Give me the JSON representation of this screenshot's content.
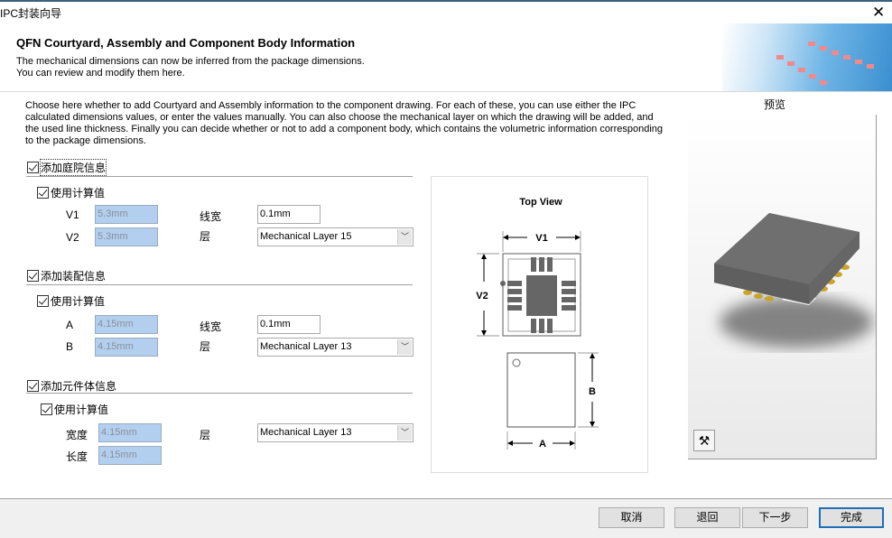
{
  "window": {
    "title": "IPC封装向导",
    "close_icon": "close-icon"
  },
  "header": {
    "title": "QFN Courtyard, Assembly and Component Body Information",
    "desc1": "The mechanical dimensions can now be inferred from the package dimensions.",
    "desc2": "You can review and modify them here."
  },
  "intro": "Choose here whether to add Courtyard and Assembly information to the component drawing. For each of these, you can use either the IPC calculated dimensions values, or enter the values manually. You can also choose the mechanical layer on which the drawing will be added, and the used line thickness. Finally you can decide whether or not to add a component body, which contains the volumetric information corresponding to the package dimensions.",
  "courtyard": {
    "label": "添加庭院信息",
    "checked": true,
    "use_calc": "使用计算值",
    "use_calc_checked": true,
    "v1_label": "V1",
    "v1": "5.3mm",
    "v2_label": "V2",
    "v2": "5.3mm",
    "width_label": "线宽",
    "width": "0.1mm",
    "layer_label": "层",
    "layer": "Mechanical Layer 15"
  },
  "assembly": {
    "label": "添加装配信息",
    "checked": true,
    "use_calc": "使用计算值",
    "use_calc_checked": true,
    "a_label": "A",
    "a": "4.15mm",
    "b_label": "B",
    "b": "4.15mm",
    "width_label": "线宽",
    "width": "0.1mm",
    "layer_label": "层",
    "layer": "Mechanical Layer 13"
  },
  "body": {
    "label": "添加元件体信息",
    "checked": true,
    "use_calc": "使用计算值",
    "use_calc_checked": true,
    "w_label": "宽度",
    "w": "4.15mm",
    "l_label": "长度",
    "l": "4.15mm",
    "layer_label": "层",
    "layer": "Mechanical Layer 13"
  },
  "diagram": {
    "title": "Top View",
    "v1": "V1",
    "v2": "V2",
    "a": "A",
    "b": "B"
  },
  "preview": {
    "label": "预览",
    "tool_icon": "hammer-filter-icon"
  },
  "footer": {
    "cancel": "取消",
    "back": "退回",
    "next": "下一步",
    "finish": "完成"
  },
  "colors": {
    "readonly_field": "#b3cff0",
    "primary_border": "#1e6fb8",
    "chip_body": "#6e6e6e",
    "pins": "#c8a52a"
  }
}
